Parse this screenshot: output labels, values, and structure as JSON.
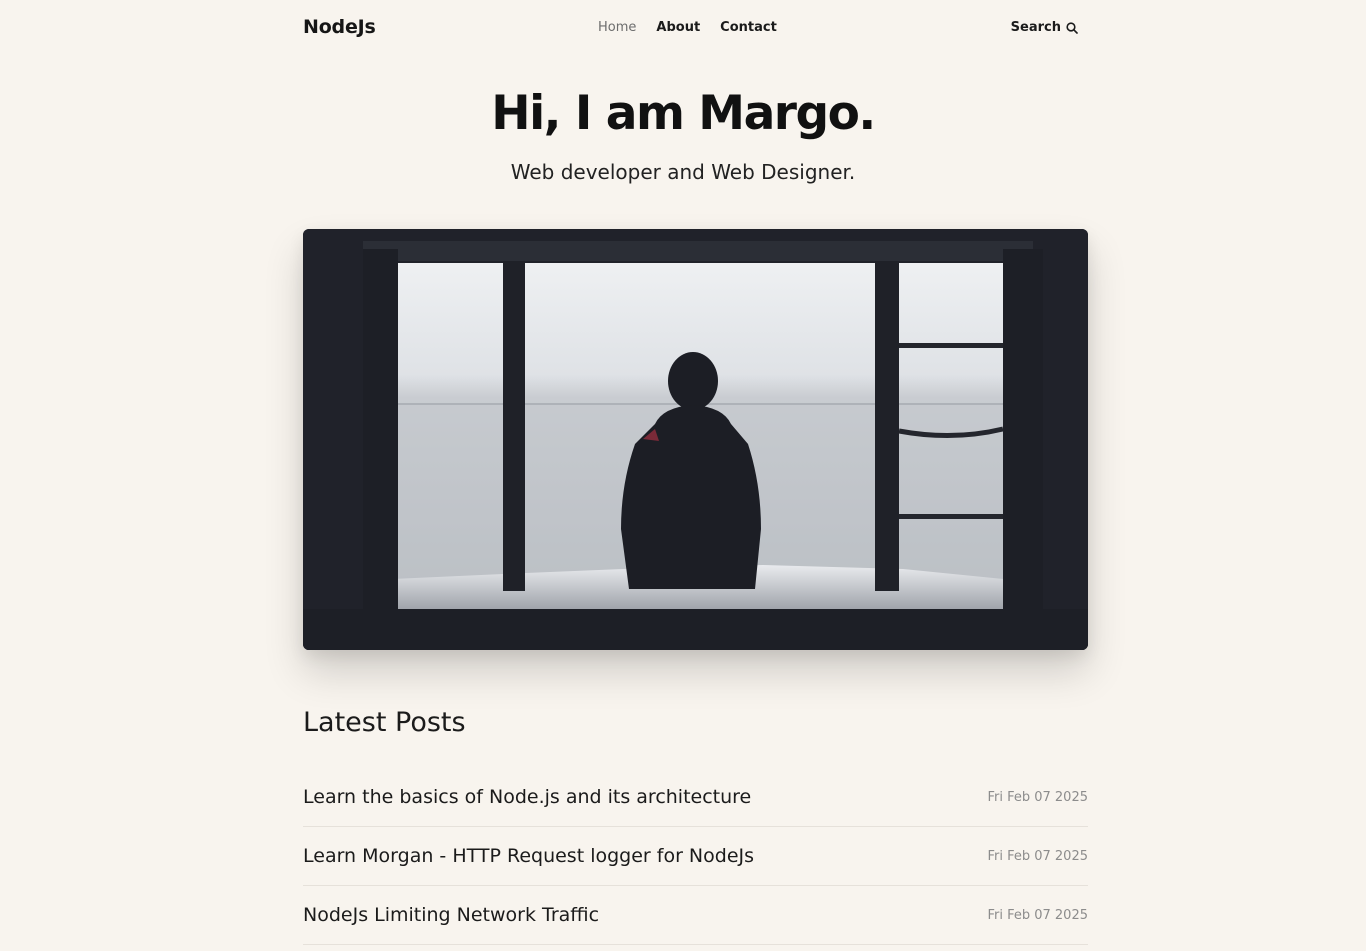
{
  "header": {
    "logo": "NodeJs",
    "nav": [
      {
        "label": "Home",
        "active": true
      },
      {
        "label": "About",
        "active": false
      },
      {
        "label": "Contact",
        "active": false
      }
    ],
    "search_label": "Search",
    "search_icon": "search-icon"
  },
  "hero": {
    "title": "Hi, I am Margo.",
    "subtitle": "Web developer and Web Designer.",
    "image_icon": "hero-photo"
  },
  "posts": {
    "heading": "Latest Posts",
    "items": [
      {
        "title": "Learn the basics of Node.js and its architecture",
        "date": "Fri Feb 07 2025"
      },
      {
        "title": "Learn Morgan - HTTP Request logger for NodeJs",
        "date": "Fri Feb 07 2025"
      },
      {
        "title": "NodeJs Limiting Network Traffic",
        "date": "Fri Feb 07 2025"
      }
    ]
  },
  "colors": {
    "background": "#f8f4ee",
    "text": "#1b1b1b",
    "muted": "#8c8c8c",
    "nav_active": "#6d6d6d"
  }
}
